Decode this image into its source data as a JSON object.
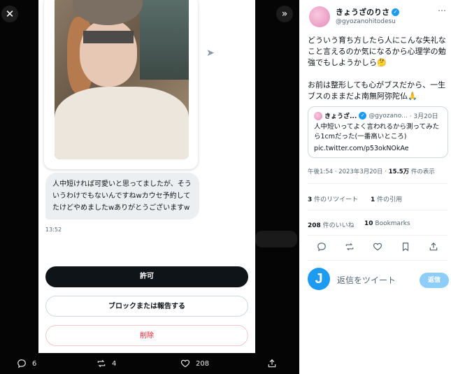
{
  "viewer": {
    "close_icon": "close-icon",
    "expand_icon": "expand-icon",
    "message_text": "人中短ければ可愛いと思ってましたが、そういうわけでもないんですねwカウセ予約してたけどやめましたwありがとうございますw",
    "message_time": "13:52",
    "buttons": {
      "allow": "許可",
      "block": "ブロックまたは報告する",
      "delete": "削除"
    },
    "bottom": {
      "replies": "6",
      "retweets": "4",
      "likes": "208"
    }
  },
  "tweet": {
    "display_name": "きょうざのりさ",
    "handle": "@gyozanohitodesu",
    "text_p1": "どういう育ち方したら人にこんな失礼なこと言えるのか気になるから心理学の勉強でもしようかしら🤔",
    "text_p2": "お前は整形しても心がブスだから、一生ブスのままだよ南無阿弥陀仏🙏",
    "quote": {
      "name": "きょうざ...",
      "handle": "@gyozano...",
      "date": "· 3月20日",
      "text": "人中短いってよく言われるから測ってみたら1cmだった(一番高いところ)",
      "link": "pic.twitter.com/p53okNOkAe"
    },
    "time": "午後1:54 · 2023年3月20日 · ",
    "views_count": "15.5万",
    "views_label": " 件の表示",
    "retweets_count": "3",
    "retweets_label": " 件のリツイート",
    "quotes_count": "1",
    "quotes_label": " 件の引用",
    "likes_count": "208",
    "likes_label": " 件のいいね",
    "bookmarks_count": "10",
    "bookmarks_label": " Bookmarks",
    "reply_placeholder": "返信をツイート",
    "reply_button": "返信"
  },
  "colors": {
    "accent": "#1d9bf0",
    "danger": "#f4212e"
  }
}
